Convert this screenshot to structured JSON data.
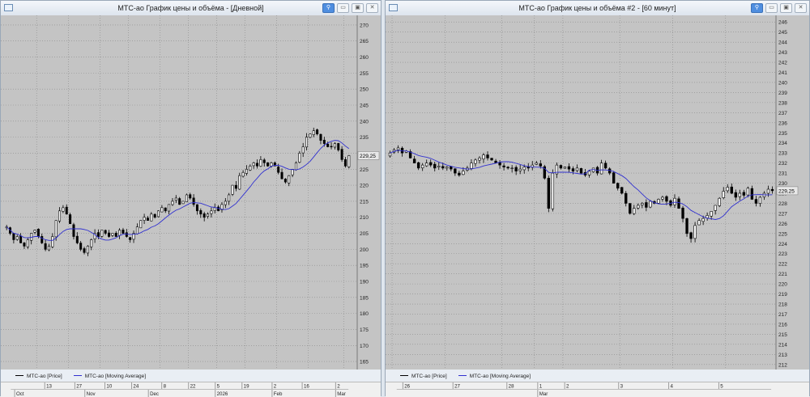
{
  "windows": [
    {
      "title": "МТС-ао График цены и объёма - [Дневной]",
      "legend": {
        "price": "МТС-ао [Price]",
        "ma": "МТС-ао [Moving Average]"
      },
      "last_label": "229,25"
    },
    {
      "title": "МТС-ао График цены и объёма #2 - [60 минут]",
      "legend": {
        "price": "МТС-ао [Price]",
        "ma": "МТС-ао [Moving Average]"
      },
      "last_label": "229,25"
    }
  ],
  "colors": {
    "price": "#000000",
    "ma": "#3030d0",
    "plot_bg": "#c4c4c4",
    "grid": "#8a8a8a"
  },
  "chart_data": [
    {
      "type": "candlestick",
      "title": "МТС-ао График цены и объёма - [Дневной]",
      "ylim": [
        162.5,
        272.5
      ],
      "yticks": [
        165,
        170,
        175,
        180,
        185,
        190,
        195,
        200,
        205,
        210,
        215,
        220,
        225,
        230,
        235,
        240,
        245,
        250,
        255,
        260,
        265,
        270
      ],
      "ma_period": 10,
      "closes": [
        207,
        205,
        203,
        204,
        202,
        201,
        203,
        205,
        206,
        204,
        202,
        200,
        201,
        204,
        209,
        212,
        213,
        211,
        208,
        204,
        202,
        200,
        199,
        201,
        203,
        205,
        204,
        206,
        205,
        204,
        205,
        204,
        206,
        205,
        204,
        203,
        205,
        207,
        209,
        210,
        209,
        211,
        210,
        212,
        213,
        212,
        214,
        215,
        216,
        214,
        215,
        217,
        216,
        214,
        212,
        211,
        210,
        211,
        212,
        213,
        212,
        214,
        215,
        217,
        220,
        219,
        223,
        224,
        225,
        226,
        227,
        226,
        228,
        227,
        226,
        227,
        226,
        224,
        222,
        221,
        223,
        225,
        227,
        230,
        232,
        235,
        236,
        237,
        236,
        234,
        233,
        232,
        232,
        233,
        231,
        228,
        226,
        229.25
      ],
      "day_ticks": [
        {
          "label": "13",
          "bar": 9
        },
        {
          "label": "27",
          "bar": 18
        },
        {
          "label": "10",
          "bar": 27
        },
        {
          "label": "24",
          "bar": 35
        },
        {
          "label": "8",
          "bar": 44
        },
        {
          "label": "22",
          "bar": 52
        },
        {
          "label": "5",
          "bar": 60
        },
        {
          "label": "19",
          "bar": 68
        },
        {
          "label": "2",
          "bar": 77
        },
        {
          "label": "16",
          "bar": 86
        },
        {
          "label": "2",
          "bar": 96
        }
      ],
      "month_ticks": [
        {
          "label": "Oct",
          "bar": 0
        },
        {
          "label": "Nov",
          "bar": 21
        },
        {
          "label": "Dec",
          "bar": 40
        },
        {
          "label": "2026",
          "bar": 60
        },
        {
          "label": "Feb",
          "bar": 77
        },
        {
          "label": "Mar",
          "bar": 96
        }
      ]
    },
    {
      "type": "candlestick",
      "title": "МТС-ао График цены и объёма #2 - [60 минут]",
      "ylim": [
        211.5,
        246.5
      ],
      "yticks": [
        212,
        213,
        214,
        215,
        216,
        217,
        218,
        219,
        220,
        221,
        222,
        223,
        224,
        225,
        226,
        227,
        228,
        229,
        230,
        231,
        232,
        233,
        234,
        235,
        236,
        237,
        238,
        239,
        240,
        241,
        242,
        243,
        244,
        245,
        246
      ],
      "ma_period": 10,
      "closes": [
        233,
        233.3,
        233.5,
        233,
        233.2,
        232.5,
        232,
        231.5,
        231.8,
        232,
        231.8,
        231.5,
        231.7,
        231.5,
        231.6,
        231.4,
        231,
        230.8,
        231.2,
        231.5,
        232,
        232.3,
        232.5,
        232.8,
        232.5,
        232.3,
        232,
        231.8,
        231.6,
        231.5,
        231.5,
        231.2,
        231.4,
        231.6,
        231.5,
        231.8,
        232,
        231.7,
        230.5,
        227.5,
        231,
        231.8,
        231.5,
        231.6,
        231.4,
        231.2,
        231.5,
        231,
        230.8,
        231.2,
        231.5,
        231,
        232,
        231.5,
        231,
        230,
        229.5,
        229,
        228,
        227,
        227.5,
        227.8,
        228,
        227.6,
        228.2,
        228,
        228.4,
        228.6,
        228.2,
        227.8,
        228.5,
        227.5,
        226.5,
        225,
        224.5,
        225.8,
        226.3,
        226.5,
        226.8,
        227.2,
        227.8,
        228.5,
        229.2,
        229.6,
        229,
        228.6,
        229,
        228.8,
        229.5,
        228.4,
        228,
        228.6,
        229,
        229.4,
        229.25
      ],
      "day_ticks": [
        {
          "label": "26",
          "bar": 1
        },
        {
          "label": "27",
          "bar": 14
        },
        {
          "label": "28",
          "bar": 28
        },
        {
          "label": "1",
          "bar": 36
        },
        {
          "label": "2",
          "bar": 43
        },
        {
          "label": "3",
          "bar": 57
        },
        {
          "label": "4",
          "bar": 70
        },
        {
          "label": "5",
          "bar": 83
        }
      ],
      "month_ticks": [
        {
          "label": "Mar",
          "bar": 36
        }
      ]
    }
  ]
}
